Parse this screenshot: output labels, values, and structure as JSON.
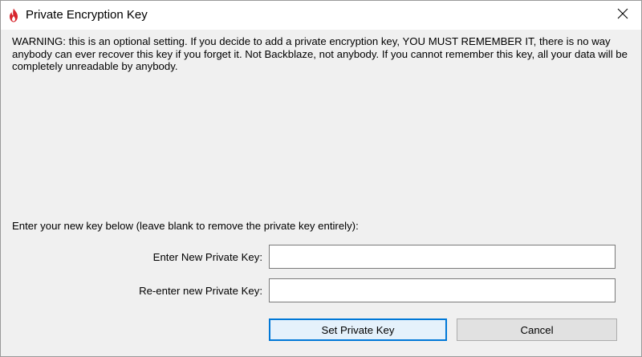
{
  "window": {
    "title": "Private Encryption Key",
    "app_icon": "backblaze-flame-icon",
    "close_icon": "close-icon",
    "accent_color": "#d7262e"
  },
  "content": {
    "warning": "WARNING: this is an optional setting.  If you decide to add a private encryption key, YOU MUST REMEMBER IT, there is no way anybody can ever recover this key if you forget it.  Not Backblaze, not anybody.  If you cannot remember this key, all your data will be completely unreadable by anybody.",
    "instructions": "Enter your new key below (leave blank to remove the private key entirely):"
  },
  "form": {
    "new_key_label": "Enter New Private Key:",
    "new_key_value": "",
    "reenter_key_label": "Re-enter new Private Key:",
    "reenter_key_value": ""
  },
  "buttons": {
    "set_label": "Set Private Key",
    "cancel_label": "Cancel",
    "default_border_color": "#0078d7"
  }
}
